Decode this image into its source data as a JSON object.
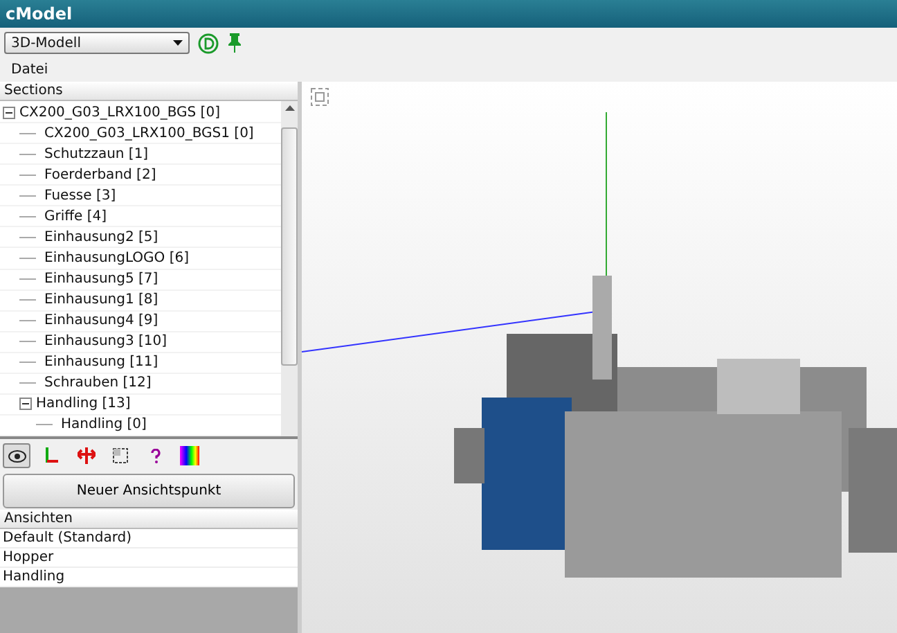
{
  "window": {
    "title": "cModel"
  },
  "toolbar": {
    "view_select": {
      "value": "3D-Modell"
    }
  },
  "menu": [
    "Datei"
  ],
  "sections": {
    "header": "Sections",
    "tree": [
      {
        "label": "CX200_G03_LRX100_BGS [0]",
        "expanded": true,
        "children": [
          {
            "label": "CX200_G03_LRX100_BGS1 [0]"
          },
          {
            "label": "Schutzzaun [1]"
          },
          {
            "label": "Foerderband [2]"
          },
          {
            "label": "Fuesse [3]"
          },
          {
            "label": "Griffe [4]"
          },
          {
            "label": "Einhausung2 [5]"
          },
          {
            "label": "EinhausungLOGO [6]"
          },
          {
            "label": "Einhausung5 [7]"
          },
          {
            "label": "Einhausung1 [8]"
          },
          {
            "label": "Einhausung4 [9]"
          },
          {
            "label": "Einhausung3 [10]"
          },
          {
            "label": "Einhausung [11]"
          },
          {
            "label": "Schrauben [12]"
          },
          {
            "label": "Handling [13]",
            "expanded": true,
            "children": [
              {
                "label": "Handling [0]"
              }
            ]
          }
        ]
      }
    ]
  },
  "view_tools": [
    {
      "kind": "eye",
      "selected": true
    },
    {
      "kind": "axes",
      "selected": false
    },
    {
      "kind": "move",
      "selected": false
    },
    {
      "kind": "frame",
      "selected": false
    },
    {
      "kind": "help",
      "selected": false
    },
    {
      "kind": "colors",
      "selected": false
    }
  ],
  "new_view_button": "Neuer Ansichtspunkt",
  "views": {
    "header": "Ansichten",
    "items": [
      "Default (Standard)",
      "Hopper",
      "Handling"
    ]
  }
}
